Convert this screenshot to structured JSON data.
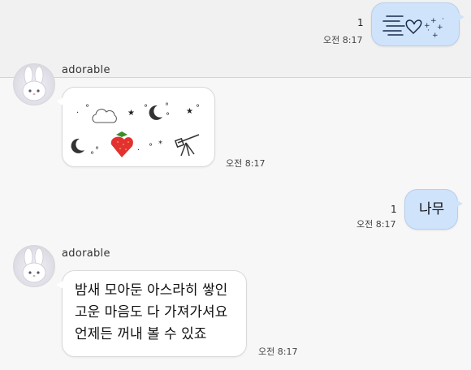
{
  "messages": [
    {
      "from": "me",
      "unread": "1",
      "time": "오전 8:17",
      "content_icon": "sparkle-heart-sticker"
    },
    {
      "from": "adorable",
      "sender": "adorable",
      "time": "오전 8:17",
      "content_icon": "night-sky-emoticons"
    },
    {
      "from": "me",
      "unread": "1",
      "time": "오전 8:17",
      "text": "나무"
    },
    {
      "from": "adorable",
      "sender": "adorable",
      "time": "오전 8:17",
      "lines": [
        "밤새 모아둔 아스라히 쌓인",
        "고운 마음도 다 가져가셔요",
        "언제든 꺼내 볼 수 있죠"
      ]
    }
  ],
  "colors": {
    "outgoing_bubble": "#cfe3fb",
    "incoming_bubble": "#ffffff",
    "background": "#f4f4f4"
  }
}
